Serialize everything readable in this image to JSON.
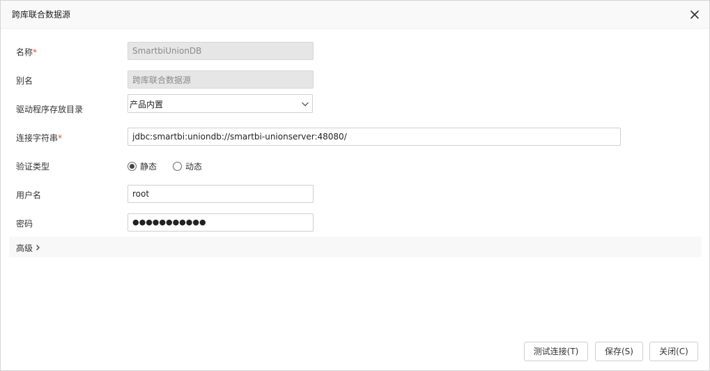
{
  "dialog": {
    "title": "跨库联合数据源",
    "close_icon": "close-icon"
  },
  "form": {
    "name": {
      "label": "名称",
      "required_mark": "*",
      "value": "SmartbiUnionDB"
    },
    "alias": {
      "label": "别名",
      "value": "跨库联合数据源"
    },
    "driver_dir": {
      "label": "驱动程序存放目录",
      "selected": "产品内置"
    },
    "connection_string": {
      "label": "连接字符串",
      "required_mark": "*",
      "value": "jdbc:smartbi:uniondb://smartbi-unionserver:48080/"
    },
    "auth_type": {
      "label": "验证类型",
      "options": [
        {
          "label": "静态",
          "checked": true
        },
        {
          "label": "动态",
          "checked": false
        }
      ]
    },
    "username": {
      "label": "用户名",
      "value": "root"
    },
    "password": {
      "label": "密码",
      "value": "●●●●●●●●●●●"
    },
    "advanced": {
      "label": "高级"
    }
  },
  "buttons": {
    "test": "测试连接(T)",
    "save": "保存(S)",
    "close": "关闭(C)"
  }
}
